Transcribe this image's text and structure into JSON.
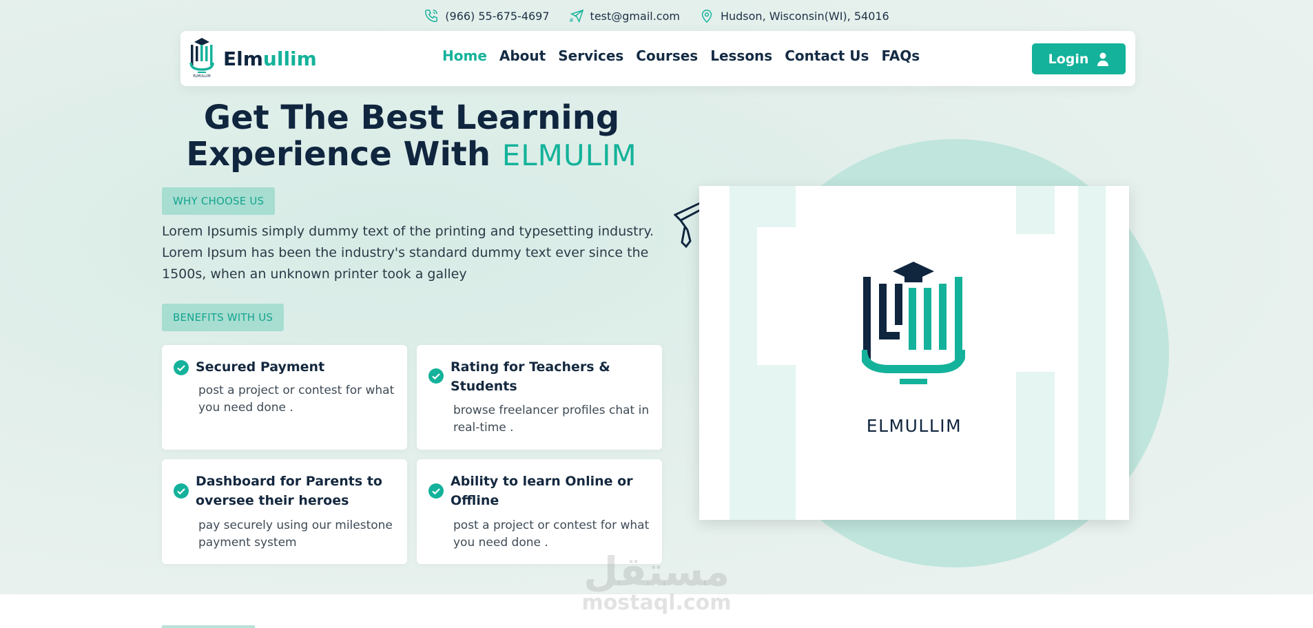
{
  "topbar": {
    "phone": "(966) 55-675-4697",
    "email": "test@gmail.com",
    "address": "Hudson, Wisconsin(WI), 54016"
  },
  "brand": {
    "name_part1": "Elm",
    "name_part2": "ullim",
    "logo_caption": "ELMULLIM"
  },
  "nav": {
    "items": [
      "Home",
      "About",
      "Services",
      "Courses",
      "Lessons",
      "Contact Us",
      "FAQs"
    ],
    "active": "Home"
  },
  "login": {
    "label": "Login"
  },
  "hero": {
    "headline_line1": "Get The Best Learning",
    "headline_line2": "Experience With",
    "headline_brand": "ELMULIM",
    "why_label": "WHY CHOOSE US",
    "description": "Lorem Ipsumis simply dummy text of the printing and typesetting industry. Lorem Ipsum has been the industry's standard dummy text ever since the 1500s, when an unknown printer took a galley",
    "benefits_label": "BENEFITS WITH US"
  },
  "benefits": [
    {
      "title": "Secured Payment",
      "desc": "post a project or contest for what you need done ."
    },
    {
      "title": "Rating for Teachers & Students",
      "desc": "browse freelancer profiles chat in real-time ."
    },
    {
      "title": "Dashboard for Parents to oversee their heroes",
      "desc": "pay securely using our milestone payment system"
    },
    {
      "title": "Ability to learn Online or Offline",
      "desc": "post a project or contest for what you need done ."
    }
  ],
  "showcase": {
    "logo_word": "ELMULLIM"
  },
  "watermark": {
    "arabic": "مستقل",
    "latin": "mostaql.com"
  },
  "colors": {
    "accent": "#14b29a",
    "navy": "#10253e",
    "pill_bg": "#a8ddd1",
    "circle": "#bfe5dc"
  },
  "icons": {
    "phone": "phone-icon",
    "email": "paper-plane-icon",
    "address": "location-pin-icon",
    "login": "user-icon",
    "check": "check-circle-icon"
  }
}
